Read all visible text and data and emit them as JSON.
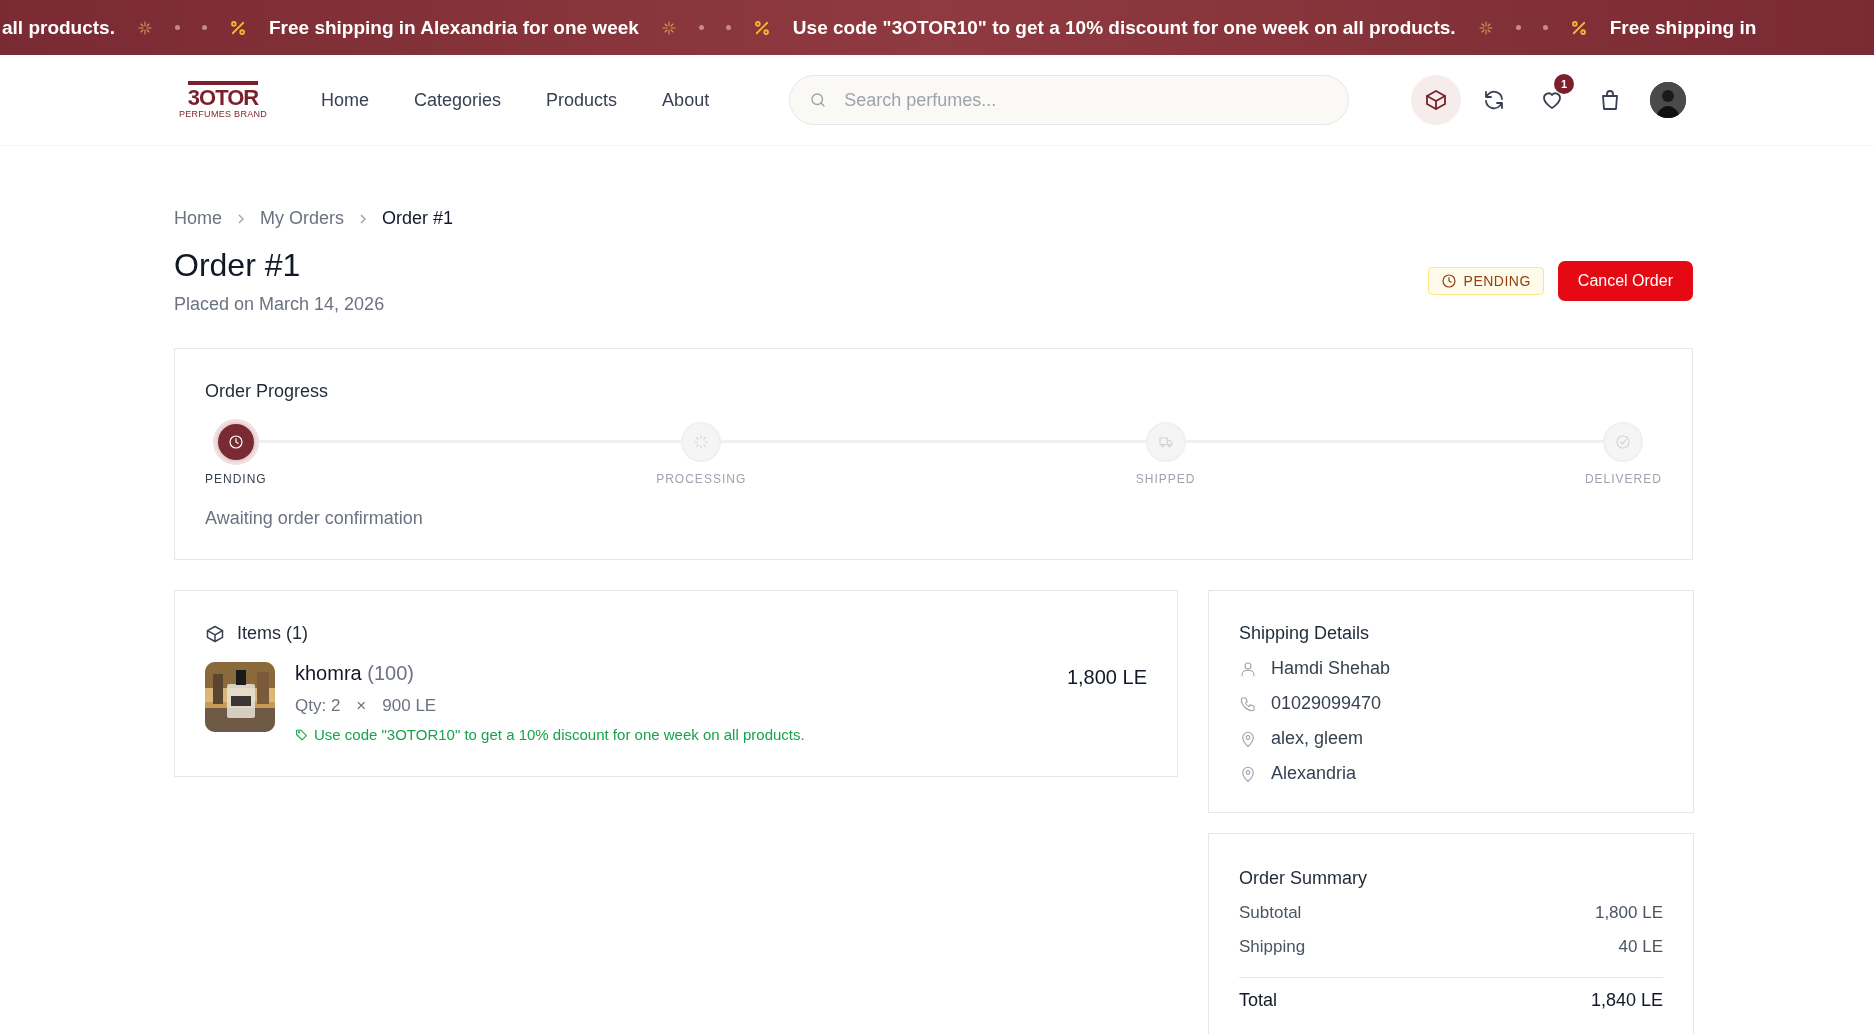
{
  "announcement_bar": {
    "items": [
      {
        "kind": "text",
        "text": "all products."
      },
      {
        "kind": "sparkle"
      },
      {
        "kind": "dot"
      },
      {
        "kind": "dot"
      },
      {
        "kind": "percent"
      },
      {
        "kind": "text",
        "text": "Free shipping in Alexandria for one week"
      },
      {
        "kind": "sparkle"
      },
      {
        "kind": "dot"
      },
      {
        "kind": "dot"
      },
      {
        "kind": "percent"
      },
      {
        "kind": "text",
        "text": "Use code \"3OTOR10\" to get a 10% discount for one week on all products."
      },
      {
        "kind": "sparkle"
      },
      {
        "kind": "dot"
      },
      {
        "kind": "dot"
      },
      {
        "kind": "percent"
      },
      {
        "kind": "text",
        "text": "Free shipping in"
      }
    ]
  },
  "header": {
    "logo": {
      "name": "3OTOR",
      "tagline": "PERFUMES BRAND"
    },
    "nav": [
      {
        "label": "Home"
      },
      {
        "label": "Categories"
      },
      {
        "label": "Products"
      },
      {
        "label": "About"
      }
    ],
    "search": {
      "placeholder": "Search perfumes..."
    },
    "actions": [
      {
        "kind": "orders",
        "selected": true
      },
      {
        "kind": "refresh",
        "selected": false
      },
      {
        "kind": "wishlist",
        "selected": false,
        "badge": "1"
      },
      {
        "kind": "cart",
        "selected": false
      }
    ]
  },
  "breadcrumb": [
    {
      "label": "Home",
      "current": false
    },
    {
      "label": "My Orders",
      "current": false
    },
    {
      "label": "Order #1",
      "current": true
    }
  ],
  "order": {
    "title": "Order #1",
    "placed": "Placed on March 14, 2026",
    "status": "PENDING",
    "cancel_button": "Cancel Order"
  },
  "progress": {
    "title": "Order Progress",
    "steps": [
      {
        "kind": "pending",
        "label": "PENDING",
        "active": true
      },
      {
        "kind": "processing",
        "label": "PROCESSING",
        "active": false
      },
      {
        "kind": "shipped",
        "label": "SHIPPED",
        "active": false
      },
      {
        "kind": "delivered",
        "label": "DELIVERED",
        "active": false
      }
    ],
    "message": "Awaiting order confirmation"
  },
  "items": {
    "title": "Items (1)",
    "list": [
      {
        "kind": "picture",
        "name": "khomra",
        "size": "(100)",
        "qty": "Qty: 2",
        "times": "×",
        "unit_price": "900 LE",
        "price": "1,800 LE",
        "promo": "Use code \"3OTOR10\" to get a 10% discount for one week on all products."
      }
    ]
  },
  "shipping": {
    "title": "Shipping Details",
    "rows": [
      {
        "kind": "person",
        "text": "Hamdi Shehab"
      },
      {
        "kind": "phone",
        "text": "01029099470"
      },
      {
        "kind": "pin",
        "text": "alex, gleem"
      },
      {
        "kind": "pin",
        "text": "Alexandria"
      }
    ]
  },
  "summary": {
    "title": "Order Summary",
    "rows": [
      {
        "label": "Subtotal",
        "value": "1,800 LE",
        "total": false
      },
      {
        "label": "Shipping",
        "value": "40 LE",
        "total": false
      },
      {
        "label": "Total",
        "value": "1,840 LE",
        "total": true
      }
    ]
  }
}
